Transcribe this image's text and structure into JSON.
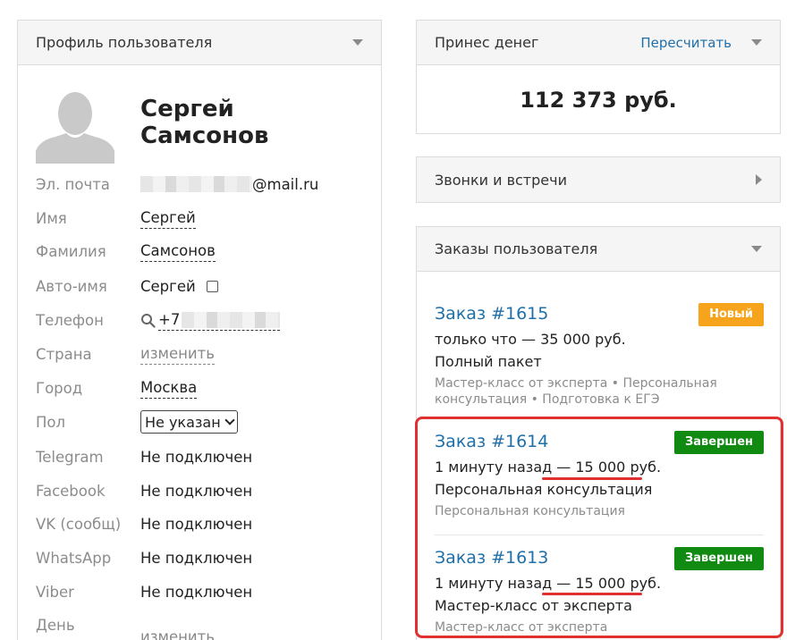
{
  "profile": {
    "header": "Профиль пользователя",
    "first_name_line": "Сергей",
    "last_name_line": "Самсонов",
    "fields": {
      "email_label": "Эл. почта",
      "email_value": "@mail.ru",
      "name_label": "Имя",
      "name_value": "Сергей",
      "surname_label": "Фамилия",
      "surname_value": "Самсонов",
      "autoname_label": "Авто-имя",
      "autoname_value": "Сергей",
      "phone_label": "Телефон",
      "phone_value": "+7",
      "country_label": "Страна",
      "country_value": "изменить",
      "city_label": "Город",
      "city_value": "Москва",
      "gender_label": "Пол",
      "gender_value": "Не указан",
      "telegram_label": "Telegram",
      "telegram_value": "Не подключен",
      "facebook_label": "Facebook",
      "facebook_value": "Не подключен",
      "vk_label": "VK (сообщ)",
      "vk_value": "Не подключен",
      "whatsapp_label": "WhatsApp",
      "whatsapp_value": "Не подключен",
      "viber_label": "Viber",
      "viber_value": "Не подключен",
      "birthday_label": "День",
      "birthday_value": "изменить"
    }
  },
  "money": {
    "header": "Принес денег",
    "recalc_link": "Пересчитать",
    "amount": "112 373 руб."
  },
  "calls": {
    "header": "Звонки и встречи"
  },
  "orders": {
    "header": "Заказы пользователя",
    "items": [
      {
        "title": "Заказ #1615",
        "status": "Новый",
        "time": "только что",
        "sum": "35 000 руб.",
        "package": "Полный пакет",
        "tags": "Мастер-класс от эксперта • Персональная консультация • Подготовка к ЕГЭ"
      },
      {
        "title": "Заказ #1614",
        "status": "Завершен",
        "time": "1 минуту назад",
        "sum": "15 000 руб.",
        "package": "Персональная консультация",
        "tags": "Персональная консультация"
      },
      {
        "title": "Заказ #1613",
        "status": "Завершен",
        "time": "1 минуту назад",
        "sum": "15 000 руб.",
        "package": "Мастер-класс от эксперта",
        "tags": "Мастер-класс от эксперта"
      }
    ],
    "dash": "—"
  },
  "colors": {
    "link": "#1f6fa8",
    "badge_new": "#f7a41d",
    "badge_done": "#118a12",
    "annotation": "#e03030"
  }
}
